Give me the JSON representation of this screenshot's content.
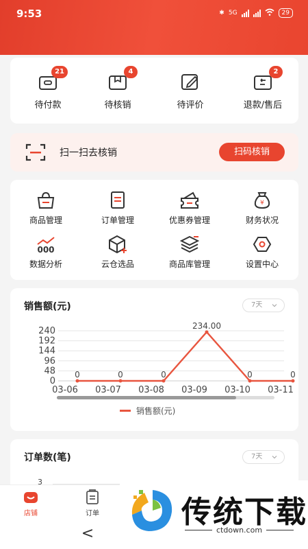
{
  "status_bar": {
    "time": "9:53",
    "battery": "29",
    "network": "5G"
  },
  "orders": [
    {
      "label": "待付款",
      "badge": "21",
      "icon": "wallet-icon"
    },
    {
      "label": "待核销",
      "badge": "4",
      "icon": "verify-box-icon"
    },
    {
      "label": "待评价",
      "badge": "",
      "icon": "edit-icon"
    },
    {
      "label": "退款/售后",
      "badge": "2",
      "icon": "refund-icon"
    }
  ],
  "scan": {
    "text": "扫一扫去核销",
    "button": "扫码核销",
    "icon": "scan-icon"
  },
  "tools": [
    {
      "label": "商品管理",
      "icon": "shopping-bag-icon"
    },
    {
      "label": "订单管理",
      "icon": "order-list-icon"
    },
    {
      "label": "优惠券管理",
      "icon": "coupon-icon"
    },
    {
      "label": "财务状况",
      "icon": "money-bag-icon"
    },
    {
      "label": "数据分析",
      "icon": "data-chart-icon"
    },
    {
      "label": "云仓选品",
      "icon": "cloud-box-icon"
    },
    {
      "label": "商品库管理",
      "icon": "layers-icon"
    },
    {
      "label": "设置中心",
      "icon": "settings-hex-icon"
    }
  ],
  "sales": {
    "title": "销售额(元)",
    "range": "7天",
    "legend": "销售额(元)"
  },
  "chart_data": {
    "type": "line",
    "title": "销售额(元)",
    "categories": [
      "03-06",
      "03-07",
      "03-08",
      "03-09",
      "03-10",
      "03-11"
    ],
    "series": [
      {
        "name": "销售额(元)",
        "values": [
          0,
          0,
          0,
          234.0,
          0,
          0
        ]
      }
    ],
    "data_labels": [
      "0",
      "0",
      "0",
      "234.00",
      "0",
      "0"
    ],
    "y_ticks": [
      "240",
      "192",
      "144",
      "96",
      "48",
      "0"
    ],
    "ylim": [
      0,
      240
    ],
    "grid": true,
    "legend_position": "bottom",
    "colors": {
      "line": "#e8553f"
    }
  },
  "orders_chart": {
    "title": "订单数(笔)",
    "range": "7天",
    "y_tick": "3"
  },
  "tabs": [
    {
      "label": "店铺",
      "icon": "store-icon",
      "active": true
    },
    {
      "label": "订单",
      "icon": "clipboard-icon",
      "active": false
    }
  ],
  "nav": {
    "back": "<"
  },
  "watermark": {
    "text": "传统下载",
    "url": "ctdown.com"
  },
  "colors": {
    "brand": "#e8452f",
    "header": "#e23e2b"
  }
}
